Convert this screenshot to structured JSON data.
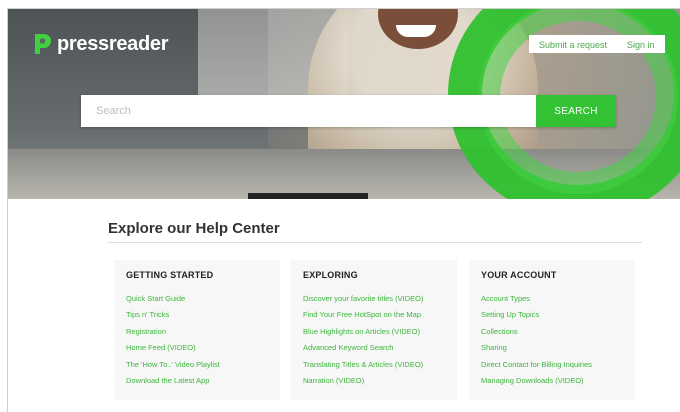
{
  "header": {
    "logo_text": "pressreader",
    "submit_request_label": "Submit a request",
    "sign_in_label": "Sign in"
  },
  "search": {
    "placeholder": "Search",
    "button_label": "SEARCH"
  },
  "main": {
    "title": "Explore our Help Center",
    "sections": [
      {
        "heading": "GETTING STARTED",
        "links": [
          "Quick Start Guide",
          "Tips n' Tricks",
          "Registration",
          "Home Feed (VIDEO)",
          "The 'How To..' Video Playlist",
          "Download the Latest App"
        ]
      },
      {
        "heading": "EXPLORING",
        "links": [
          "Discover your favorite titles (VIDEO)",
          "Find Your Free HotSpot on the Map",
          "Blue Highlights on Articles (VIDEO)",
          "Advanced Keyword Search",
          "Translating Titles & Articles (VIDEO)",
          "Narration (VIDEO)"
        ]
      },
      {
        "heading": "YOUR ACCOUNT",
        "links": [
          "Account Types",
          "Setting Up Topics",
          "Collections",
          "Sharing",
          "Direct Contact for Billing Inquiries",
          "Managing Downloads (VIDEO)"
        ]
      }
    ]
  },
  "colors": {
    "brand_green": "#33c233",
    "link_green": "#3cb53c"
  },
  "icons": {
    "logo": "pressreader-logo-icon"
  }
}
